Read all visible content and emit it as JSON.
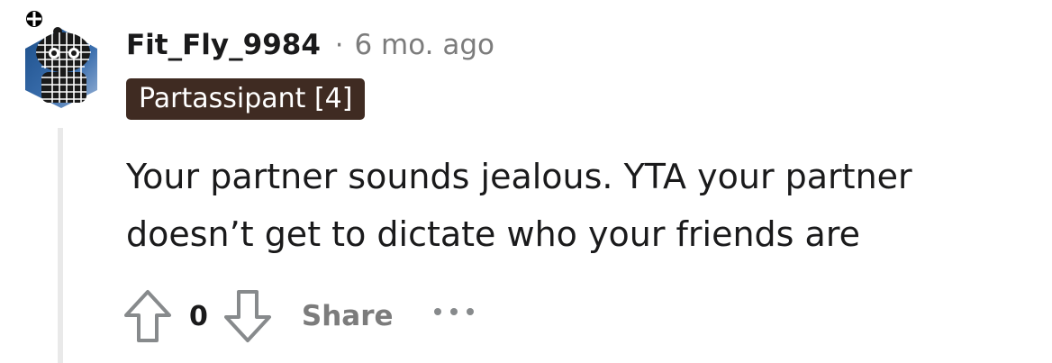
{
  "comment": {
    "author": "Fit_Fly_9984",
    "separator": "·",
    "time_ago": "6 mo. ago",
    "flair": "Partassipant [4]",
    "body": [
      "Your partner sounds jealous. YTA your partner",
      "doesn’t get to dictate who your friends are"
    ]
  },
  "actions": {
    "vote_count": "0",
    "share_label": "Share"
  },
  "icons": {
    "collapse": "collapse-circle-icon",
    "upvote": "arrow-up-icon",
    "downvote": "arrow-down-icon",
    "more": "ellipsis-icon"
  },
  "colors": {
    "flair_background": "#3f2b22",
    "muted_text": "#7c7c7c",
    "thread_line": "#e9e9e9"
  }
}
